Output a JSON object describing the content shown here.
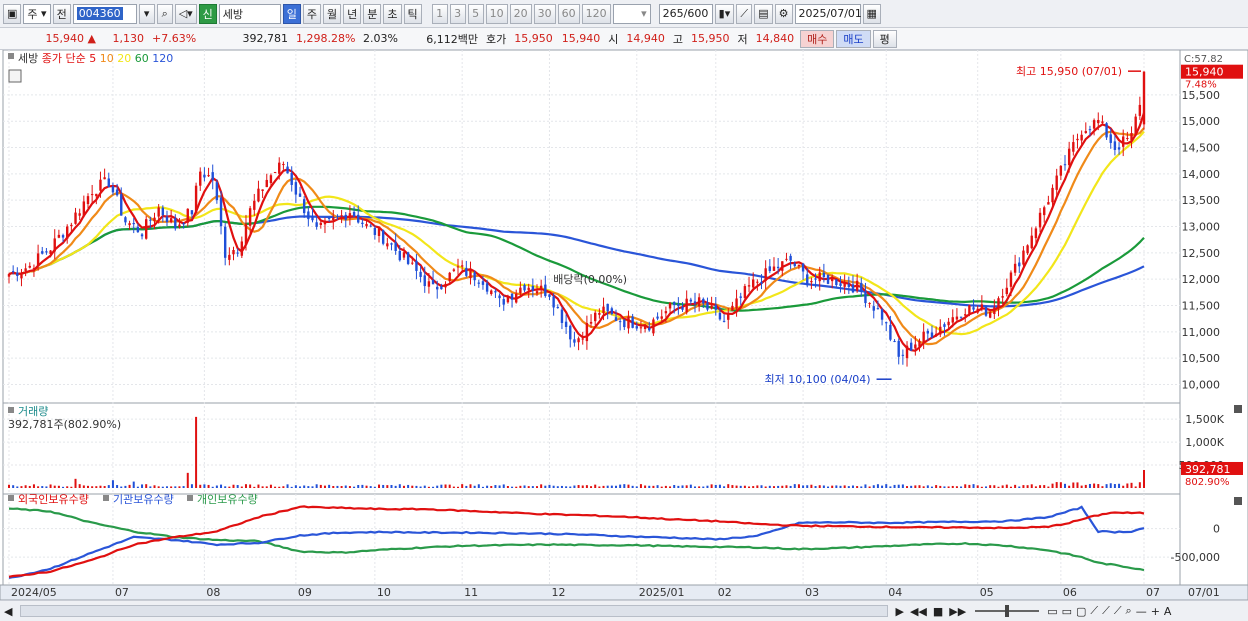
{
  "toolbar": {
    "market_label": "주",
    "prev_label": "전",
    "stock_code": "004360",
    "new_badge": "신",
    "stock_name": "세방",
    "periods": [
      "일",
      "주",
      "월",
      "년",
      "분",
      "초",
      "틱"
    ],
    "selected_period": "일",
    "intervals": [
      "1",
      "3",
      "5",
      "10",
      "20",
      "30",
      "60",
      "120"
    ],
    "count_current": "265",
    "count_total": "/600",
    "date": "2025/07/01"
  },
  "quote": {
    "price": "15,940",
    "change": "1,130",
    "change_pct": "+7.63%",
    "volume": "392,781",
    "volume_ratio": "1,298.28%",
    "turnover": "2.03%",
    "amount": "6,112백만",
    "bid_label": "호가",
    "ask": "15,950",
    "bid": "15,940",
    "open_label": "시",
    "open": "14,940",
    "high_label": "고",
    "high": "15,950",
    "low_label": "저",
    "low": "14,840",
    "buy_label": "매수",
    "sell_label": "매도",
    "eval_label": "평"
  },
  "colors": {
    "candle_up": "#e01010",
    "candle_down": "#1f4fd8",
    "ma5": "#e01010",
    "ma10": "#f08a18",
    "ma20": "#f2e61a",
    "ma60": "#1a9a3a",
    "ma120": "#2a55d8",
    "foreign": "#e01010",
    "institution": "#2a55d8",
    "individual": "#2a9a4a"
  },
  "chart_data": {
    "type": "candlestick",
    "legend": {
      "name": "세방",
      "ma_label": "종가 단순",
      "ma_periods": [
        "5",
        "10",
        "20",
        "60",
        "120"
      ]
    },
    "corner_label": "C:57.82",
    "last_price_label": "15,940",
    "last_pct_label": "7.48%",
    "price_axis": {
      "min": 9800,
      "max": 16200,
      "ticks": [
        "10,000",
        "10,500",
        "11,000",
        "11,500",
        "12,000",
        "12,500",
        "13,000",
        "13,500",
        "14,000",
        "14,500",
        "15,000",
        "15,500"
      ],
      "tick_values": [
        10000,
        10500,
        11000,
        11500,
        12000,
        12500,
        13000,
        13500,
        14000,
        14500,
        15000,
        15500
      ]
    },
    "annotations": {
      "high": "최고 15,950 (07/01)",
      "low": "최저 10,100 (04/04)",
      "dividend": "배당락(0.00%)"
    },
    "months": [
      {
        "label": "2024/05",
        "idx": 0
      },
      {
        "label": "07",
        "idx": 25
      },
      {
        "label": "08",
        "idx": 47
      },
      {
        "label": "09",
        "idx": 69
      },
      {
        "label": "10",
        "idx": 88
      },
      {
        "label": "11",
        "idx": 109
      },
      {
        "label": "12",
        "idx": 130
      },
      {
        "label": "2025/01",
        "idx": 151
      },
      {
        "label": "02",
        "idx": 170
      },
      {
        "label": "03",
        "idx": 191
      },
      {
        "label": "04",
        "idx": 211
      },
      {
        "label": "05",
        "idx": 233
      },
      {
        "label": "06",
        "idx": 253
      },
      {
        "label": "07",
        "idx": 273
      }
    ],
    "extra_month_label": "07/01",
    "price_knots": [
      [
        0,
        12100
      ],
      [
        5,
        12250
      ],
      [
        10,
        12600
      ],
      [
        15,
        13100
      ],
      [
        20,
        13700
      ],
      [
        24,
        13850
      ],
      [
        28,
        13100
      ],
      [
        32,
        12900
      ],
      [
        36,
        13350
      ],
      [
        40,
        13000
      ],
      [
        44,
        13300
      ],
      [
        46,
        14050
      ],
      [
        49,
        13900
      ],
      [
        52,
        12500
      ],
      [
        55,
        12600
      ],
      [
        58,
        13300
      ],
      [
        62,
        13900
      ],
      [
        66,
        14200
      ],
      [
        70,
        13500
      ],
      [
        74,
        12900
      ],
      [
        78,
        13100
      ],
      [
        82,
        13300
      ],
      [
        86,
        13000
      ],
      [
        90,
        12800
      ],
      [
        96,
        12300
      ],
      [
        102,
        11800
      ],
      [
        108,
        12200
      ],
      [
        114,
        12000
      ],
      [
        118,
        11550
      ],
      [
        124,
        11900
      ],
      [
        130,
        11750
      ],
      [
        136,
        10800
      ],
      [
        142,
        11400
      ],
      [
        148,
        11200
      ],
      [
        154,
        11150
      ],
      [
        160,
        11500
      ],
      [
        166,
        11550
      ],
      [
        172,
        11200
      ],
      [
        178,
        11850
      ],
      [
        184,
        12200
      ],
      [
        188,
        12350
      ],
      [
        192,
        12000
      ],
      [
        198,
        12000
      ],
      [
        204,
        11850
      ],
      [
        210,
        11300
      ],
      [
        214,
        10500
      ],
      [
        218,
        10800
      ],
      [
        224,
        11100
      ],
      [
        230,
        11450
      ],
      [
        236,
        11400
      ],
      [
        242,
        12200
      ],
      [
        248,
        13200
      ],
      [
        254,
        14200
      ],
      [
        258,
        14850
      ],
      [
        262,
        15000
      ],
      [
        266,
        14500
      ],
      [
        270,
        14700
      ],
      [
        273,
        15700
      ]
    ],
    "volume_axis": {
      "min": 0,
      "max": 1700000,
      "ticks": [
        "500,000",
        "1,000K",
        "1,500K"
      ],
      "tick_values": [
        500000,
        1000000,
        1500000
      ]
    },
    "volume_title": "거래량",
    "volume_info": "392,781주(802.90%)",
    "volume_last": "392,781",
    "volume_pct": "802.90%",
    "holdings": {
      "series_names": [
        "외국인보유수량",
        "기관보유수량",
        "개인보유수량"
      ],
      "axis_ticks": [
        "0",
        "-500,000"
      ],
      "tick_values": [
        0,
        -500000
      ],
      "min": -900000,
      "max": 500000,
      "foreign_knots": [
        [
          0,
          -850000
        ],
        [
          10,
          -750000
        ],
        [
          20,
          -550000
        ],
        [
          30,
          -280000
        ],
        [
          40,
          -150000
        ],
        [
          50,
          -50000
        ],
        [
          60,
          200000
        ],
        [
          70,
          380000
        ],
        [
          80,
          360000
        ],
        [
          90,
          340000
        ],
        [
          100,
          340000
        ],
        [
          110,
          310000
        ],
        [
          120,
          280000
        ],
        [
          130,
          250000
        ],
        [
          140,
          230000
        ],
        [
          150,
          200000
        ],
        [
          160,
          160000
        ],
        [
          170,
          130000
        ],
        [
          180,
          80000
        ],
        [
          190,
          50000
        ],
        [
          200,
          40000
        ],
        [
          210,
          30000
        ],
        [
          220,
          20000
        ],
        [
          230,
          20000
        ],
        [
          240,
          10000
        ],
        [
          250,
          30000
        ],
        [
          255,
          100000
        ],
        [
          260,
          200000
        ],
        [
          265,
          280000
        ],
        [
          273,
          270000
        ]
      ],
      "institution_knots": [
        [
          0,
          -870000
        ],
        [
          10,
          -700000
        ],
        [
          20,
          -420000
        ],
        [
          30,
          -150000
        ],
        [
          40,
          -200000
        ],
        [
          50,
          -280000
        ],
        [
          60,
          -250000
        ],
        [
          70,
          -120000
        ],
        [
          80,
          -70000
        ],
        [
          90,
          -60000
        ],
        [
          100,
          -70000
        ],
        [
          110,
          -70000
        ],
        [
          120,
          -80000
        ],
        [
          130,
          -90000
        ],
        [
          140,
          -110000
        ],
        [
          150,
          -140000
        ],
        [
          160,
          -160000
        ],
        [
          170,
          -190000
        ],
        [
          180,
          -130000
        ],
        [
          190,
          100000
        ],
        [
          200,
          110000
        ],
        [
          210,
          100000
        ],
        [
          220,
          110000
        ],
        [
          230,
          120000
        ],
        [
          240,
          130000
        ],
        [
          250,
          200000
        ],
        [
          258,
          370000
        ],
        [
          262,
          -50000
        ],
        [
          266,
          -60000
        ],
        [
          270,
          -50000
        ],
        [
          273,
          10000
        ]
      ],
      "individual_knots": [
        [
          0,
          350000
        ],
        [
          10,
          300000
        ],
        [
          20,
          100000
        ],
        [
          30,
          -50000
        ],
        [
          40,
          -150000
        ],
        [
          50,
          -200000
        ],
        [
          60,
          -220000
        ],
        [
          70,
          -400000
        ],
        [
          80,
          -420000
        ],
        [
          90,
          -370000
        ],
        [
          100,
          -330000
        ],
        [
          110,
          -300000
        ],
        [
          120,
          -290000
        ],
        [
          130,
          -280000
        ],
        [
          140,
          -290000
        ],
        [
          150,
          -290000
        ],
        [
          160,
          -310000
        ],
        [
          170,
          -320000
        ],
        [
          180,
          -330000
        ],
        [
          190,
          -360000
        ],
        [
          200,
          -340000
        ],
        [
          210,
          -310000
        ],
        [
          220,
          -280000
        ],
        [
          230,
          -260000
        ],
        [
          240,
          -300000
        ],
        [
          250,
          -380000
        ],
        [
          258,
          -500000
        ],
        [
          262,
          -600000
        ],
        [
          266,
          -640000
        ],
        [
          273,
          -720000
        ]
      ]
    }
  },
  "nav": {
    "icons": [
      "scroll-right-icon",
      "rewind-icon",
      "stop-icon",
      "play-icon",
      "zoom-slider",
      "chart-split-icon",
      "chart-merge-icon",
      "copy-icon",
      "tool-icon-1",
      "tool-icon-2",
      "tool-icon-3",
      "zoom-search-icon"
    ],
    "symbols": [
      "▶",
      "◀◀",
      "■",
      "▶▶",
      "—",
      "+",
      "A"
    ]
  }
}
